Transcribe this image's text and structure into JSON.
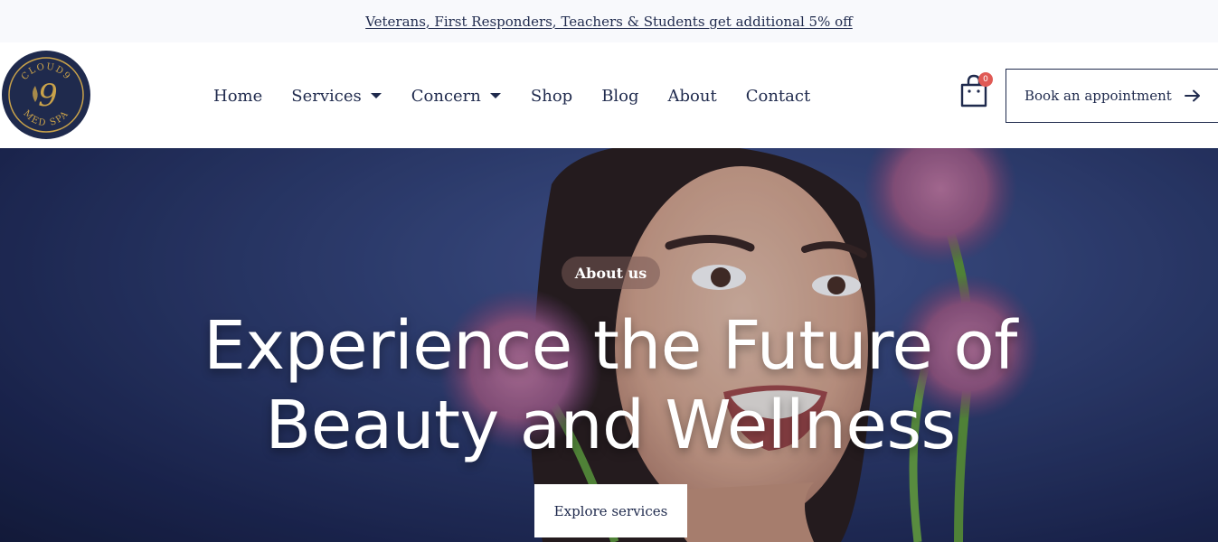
{
  "promo": {
    "text": "Veterans, First Responders, Teachers & Students get additional 5% off"
  },
  "logo": {
    "top_text": "CLOUD9",
    "bottom_text": "MED SPA",
    "monogram": "9"
  },
  "nav": {
    "items": [
      {
        "label": "Home",
        "has_dropdown": false
      },
      {
        "label": "Services",
        "has_dropdown": true
      },
      {
        "label": "Concern",
        "has_dropdown": true
      },
      {
        "label": "Shop",
        "has_dropdown": false
      },
      {
        "label": "Blog",
        "has_dropdown": false
      },
      {
        "label": "About",
        "has_dropdown": false
      },
      {
        "label": "Contact",
        "has_dropdown": false
      }
    ]
  },
  "cart": {
    "count": "0",
    "icon": "shopping-bag-icon"
  },
  "header": {
    "book_label": "Book an appointment",
    "book_icon": "arrow-right-icon"
  },
  "hero": {
    "eyebrow": "About us",
    "title_line1": "Experience the Future of",
    "title_line2": "Beauty and Wellness",
    "cta_label": "Explore services"
  },
  "colors": {
    "navy": "#1f2a4d",
    "gold": "#c9a24a",
    "badge": "#e05a55",
    "promo_bg": "#f8f9fc"
  }
}
